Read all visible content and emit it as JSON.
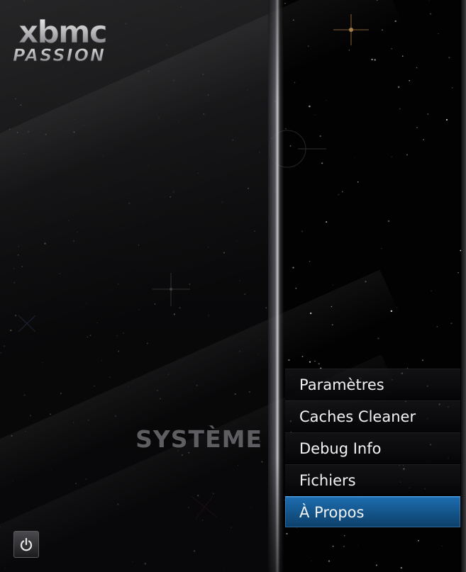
{
  "logo": {
    "top_text": "xbmc",
    "bottom_text": "PASSION"
  },
  "section": {
    "title": "SYSTÈME"
  },
  "menu": {
    "items": [
      {
        "label": "Paramètres",
        "selected": false
      },
      {
        "label": "Caches Cleaner",
        "selected": false
      },
      {
        "label": "Debug Info",
        "selected": false
      },
      {
        "label": "Fichiers",
        "selected": false
      },
      {
        "label": "À Propos",
        "selected": true
      }
    ]
  },
  "power": {
    "icon": "power-icon"
  },
  "colors": {
    "background": "#020203",
    "selection_blue": "#15588f",
    "menu_text": "#f2f2f2",
    "section_title": "#5e5e62"
  }
}
